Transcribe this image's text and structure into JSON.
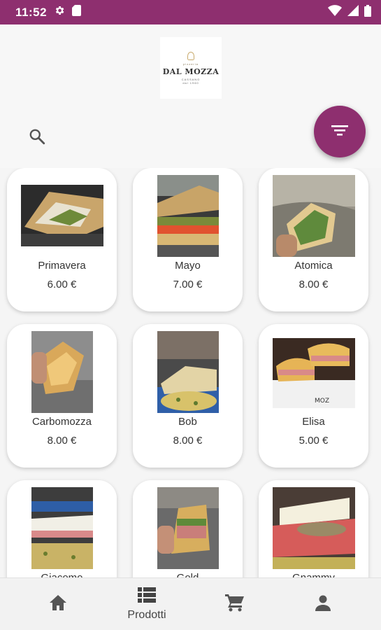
{
  "status_bar": {
    "time": "11:52"
  },
  "logo": {
    "small_text": "pizzeria",
    "name": "DAL MOZZA",
    "sub_text": "CASSANO",
    "tag": "dal 1960"
  },
  "products": [
    {
      "name": "Primavera",
      "price": "6.00 €"
    },
    {
      "name": "Mayo",
      "price": "7.00 €"
    },
    {
      "name": "Atomica",
      "price": "8.00 €"
    },
    {
      "name": "Carbomozza",
      "price": "8.00 €"
    },
    {
      "name": "Bob",
      "price": "8.00 €"
    },
    {
      "name": "Elisa",
      "price": "5.00 €"
    },
    {
      "name": "Giacomo",
      "price": ""
    },
    {
      "name": "Gold",
      "price": ""
    },
    {
      "name": "Gnammy",
      "price": ""
    }
  ],
  "bottom_nav": [
    {
      "icon": "home-icon",
      "label": ""
    },
    {
      "icon": "list-icon",
      "label": "Prodotti"
    },
    {
      "icon": "cart-icon",
      "label": ""
    },
    {
      "icon": "person-icon",
      "label": ""
    }
  ],
  "colors": {
    "primary": "#8e2f6f",
    "background": "#f5f5f5",
    "card": "#ffffff"
  }
}
